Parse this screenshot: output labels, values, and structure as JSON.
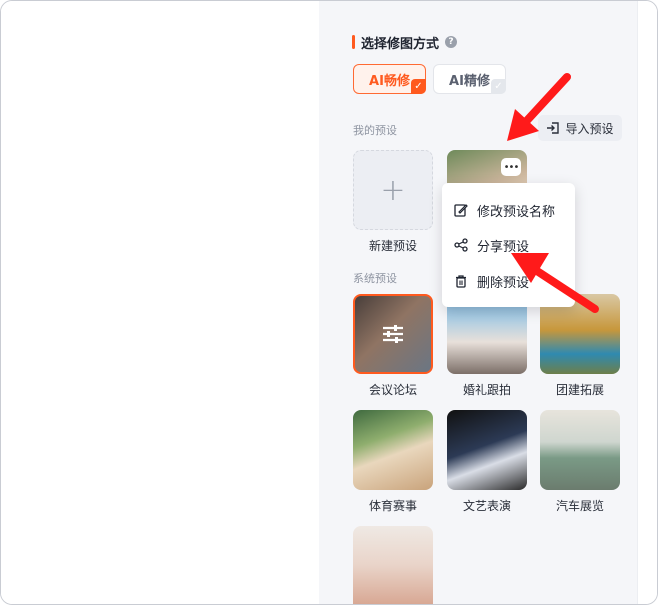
{
  "panel": {
    "section_title": "选择修图方式",
    "help_icon": "question-icon",
    "modes": [
      {
        "label": "AI畅修",
        "selected": true
      },
      {
        "label": "AI精修",
        "selected": false
      }
    ],
    "my_presets_label": "我的预设",
    "import_label": "导入预设",
    "new_preset_label": "新建预设",
    "system_presets_label": "系统预设",
    "context_menu": [
      {
        "label": "修改预设名称",
        "icon": "edit-icon"
      },
      {
        "label": "分享预设",
        "icon": "share-icon"
      },
      {
        "label": "删除预设",
        "icon": "trash-icon"
      }
    ],
    "system_presets": [
      {
        "label": "会议论坛"
      },
      {
        "label": "婚礼跟拍"
      },
      {
        "label": "团建拓展"
      },
      {
        "label": "体育赛事"
      },
      {
        "label": "文艺表演"
      },
      {
        "label": "汽车展览"
      }
    ],
    "accent_color": "#ff5a1f",
    "annotation_arrow_color": "#ff1a1a"
  }
}
